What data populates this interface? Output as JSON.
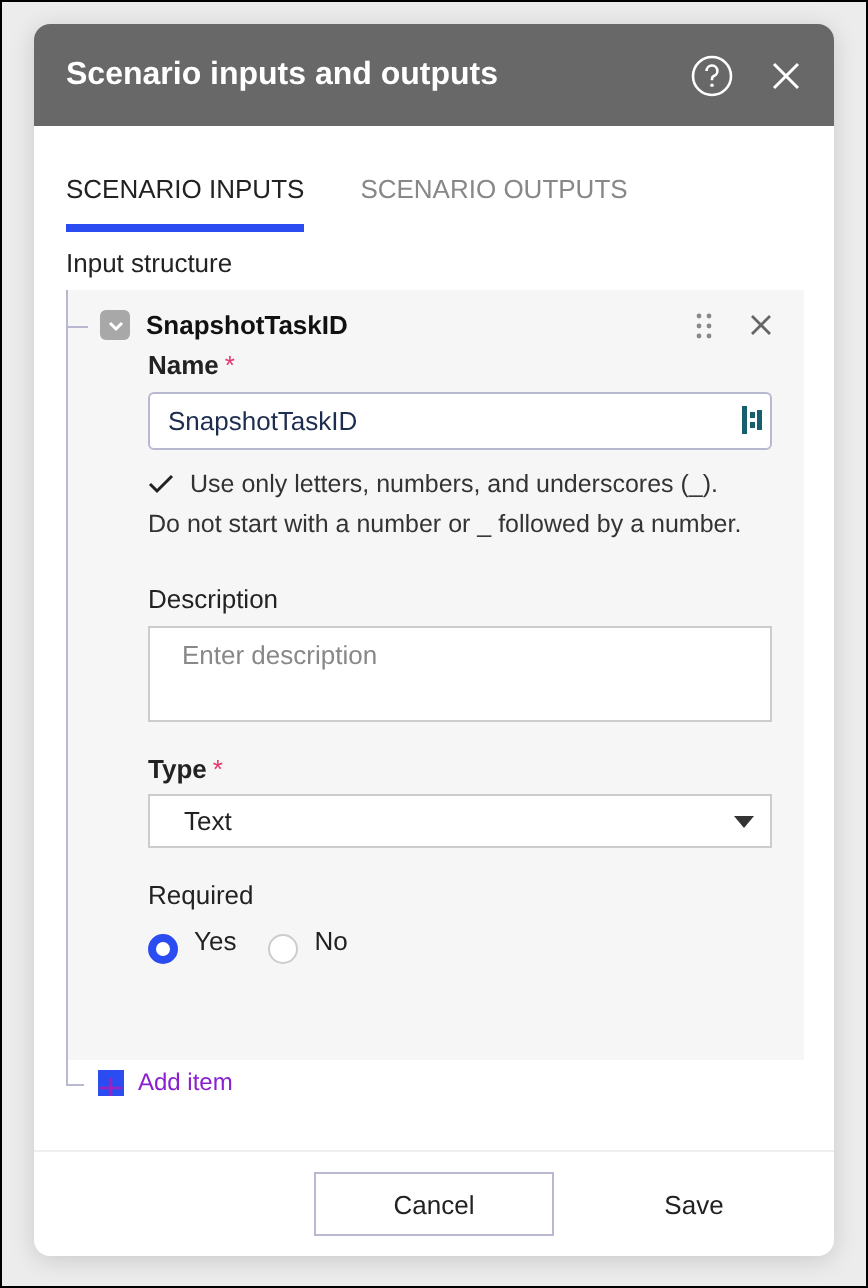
{
  "dialog": {
    "title": "Scenario inputs and outputs"
  },
  "tabs": [
    {
      "label": "SCENARIO INPUTS",
      "selected": true
    },
    {
      "label": "SCENARIO OUTPUTS",
      "selected": false
    }
  ],
  "section_label": "Input structure",
  "item": {
    "title": "SnapshotTaskID",
    "expanded": true,
    "name_label": "Name",
    "name_required_mark": "*",
    "name_value": "SnapshotTaskID",
    "hint": "Use only letters, numbers, and underscores (_). Do not start with a number or _ followed by a number.",
    "hint_valid": true,
    "description_label": "Description",
    "description_placeholder": "Enter description",
    "type_label": "Type",
    "type_required_mark": "*",
    "type_value": "Text",
    "required_label": "Required",
    "required_options": [
      {
        "label": "Yes",
        "selected": true
      },
      {
        "label": "No",
        "selected": false
      }
    ]
  },
  "add_item": "Add item",
  "buttons": [
    {
      "label": "Cancel",
      "kind": "outlined"
    },
    {
      "label": "Save",
      "kind": "plain"
    }
  ]
}
